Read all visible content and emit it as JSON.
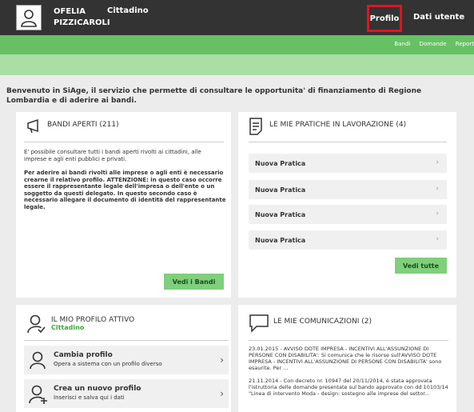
{
  "header": {
    "user_first": "OFELIA",
    "user_last": "PIZZICAROLI",
    "role": "Cittadino",
    "nav_profilo": "Profilo",
    "nav_dati": "Dati utente",
    "sublinks": [
      "Bandi",
      "Domande",
      "Report"
    ]
  },
  "welcome": "Benvenuto in SiAge, il servizio che permette di consultare le opportunita' di finanziamento di Regione Lombardia e di aderire ai bandi.",
  "bandi": {
    "title": "BANDI APERTI (211)",
    "text1": "E' possibile consultare tutti i bandi aperti rivolti ai cittadini, alle imprese e agli enti pubblici e privati.",
    "text2": "Per aderire ai bandi rivolti alle imprese o agli enti è necessario crearne il relativo profilo. ATTENZIONE: in questo caso occorre essere il rappresentante legale dell'impresa o dell'ente o un soggetto da questi delegato. In questo secondo caso è necessario allegare il documento di identità del rappresentante legale.",
    "button": "Vedi i Bandi"
  },
  "pratiche": {
    "title": "LE MIE PRATICHE IN LAVORAZIONE (4)",
    "items": [
      "Nuova Pratica",
      "Nuova Pratica",
      "Nuova Pratica",
      "Nuova Pratica"
    ],
    "chevron": "›",
    "button": "Vedi tutte"
  },
  "profilo": {
    "title": "IL MIO PROFILO ATTIVO",
    "subtitle": "Cittadino",
    "items": [
      {
        "title": "Cambia profilo",
        "subtitle": "Opera a sistema con un profilo diverso",
        "chevron": "›"
      },
      {
        "title": "Crea un nuovo profilo",
        "subtitle": "Inserisci e salva qui i dati",
        "chevron": "›"
      }
    ]
  },
  "comunicazioni": {
    "title": "LE MIE COMUNICAZIONI (2)",
    "items": [
      "23.01.2015 - AVVISO DOTE IMPRESA - INCENTIVI ALL'ASSUNZIONE DI PERSONE CON DISABILITA': Si comunica che le risorse sull'AVVISO DOTE IMPRESA - INCENTIVI ALL'ASSUNZIONE DI PERSONE CON DISABILITA' sono esaurite. Per ...",
      "21.11.2014 - Con decreto nr. 10947 del 20/11/2014, è stata approvata l'istruttoria delle domande presentate sul bando approvato con dd 10103/14 \"Linea di intervento Moda - design: sostegno alle imprese del settor..."
    ]
  },
  "colors": {
    "header_bg": "#333333",
    "green_primary": "#67c164",
    "green_light": "#a9dfa5",
    "button_green": "#7fcf7c",
    "highlight_red": "#e0141e",
    "subtitle_green": "#3aa63a"
  }
}
